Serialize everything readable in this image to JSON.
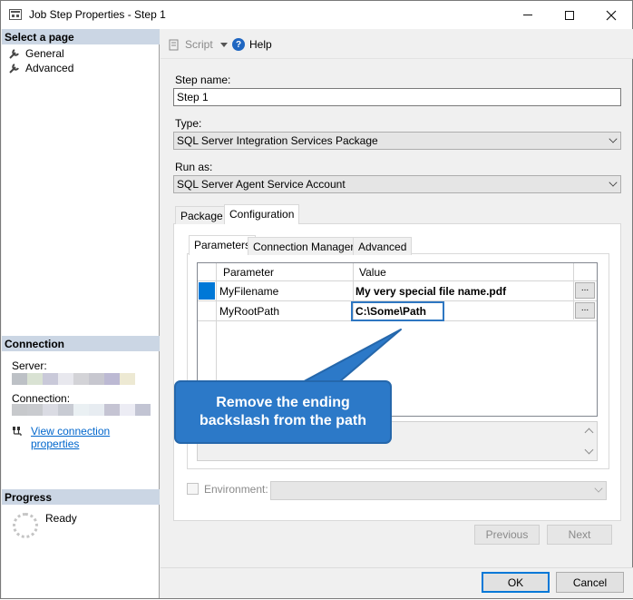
{
  "window": {
    "title": "Job Step Properties - Step 1"
  },
  "left_panel": {
    "select_page_header": "Select a page",
    "pages": [
      {
        "label": "General"
      },
      {
        "label": "Advanced"
      }
    ],
    "connection_header": "Connection",
    "server_label": "Server:",
    "connection_label": "Connection:",
    "server_swatches": [
      "#bdc1c6",
      "#d9e2d3",
      "#c9c9d9",
      "#e8e8ee",
      "#d3d3d7",
      "#c7c7cf",
      "#bcb9d3",
      "#ede9d3"
    ],
    "connection_swatches": [
      "#c7c9cc",
      "#c9cbcf",
      "#dadbe3",
      "#c8cbd3",
      "#eaf0f3",
      "#e7ecf1",
      "#c5c4d3",
      "#ececf4",
      "#c2c4d3"
    ],
    "view_connection_link": "View connection properties",
    "progress_header": "Progress",
    "progress_status": "Ready"
  },
  "toolbar": {
    "script_label": "Script",
    "help_label": "Help"
  },
  "form": {
    "step_name_label": "Step name:",
    "step_name_value": "Step 1",
    "type_label": "Type:",
    "type_value": "SQL Server Integration Services Package",
    "run_as_label": "Run as:",
    "run_as_value": "SQL Server Agent Service Account"
  },
  "outer_tabs": [
    {
      "label": "Package"
    },
    {
      "label": "Configuration",
      "active": true
    }
  ],
  "inner_tabs": [
    {
      "label": "Parameters",
      "active": true
    },
    {
      "label": "Connection Managers"
    },
    {
      "label": "Advanced"
    }
  ],
  "grid": {
    "columns": [
      "Parameter",
      "Value"
    ],
    "rows": [
      {
        "parameter": "MyFilename",
        "value": "My very special file name.pdf",
        "selected": true
      },
      {
        "parameter": "MyRootPath",
        "value": "C:\\Some\\Path",
        "highlighted": true
      }
    ],
    "ellipsis_label": "..."
  },
  "environment": {
    "label": "Environment:",
    "value": ""
  },
  "nav_buttons": {
    "previous": "Previous",
    "next": "Next"
  },
  "dialog_buttons": {
    "ok": "OK",
    "cancel": "Cancel"
  },
  "callout": {
    "line1": "Remove the ending",
    "line2": "backslash from the path"
  },
  "colors": {
    "accent": "#2c79c8",
    "selected_row": "#0078d7",
    "section_header": "#cbd6e4"
  }
}
